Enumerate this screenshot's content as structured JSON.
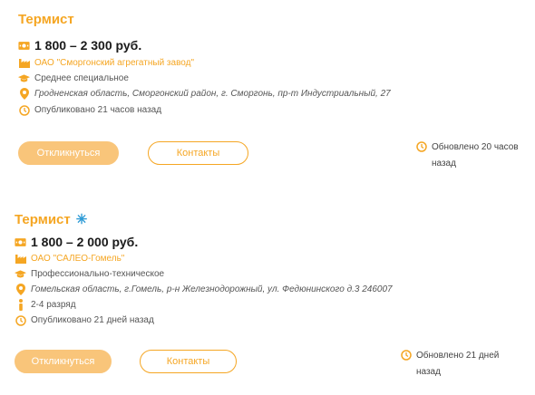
{
  "colors": {
    "accent": "#F5A623",
    "button_fill": "#F9C57A",
    "star": "#2E9BD6"
  },
  "vacancies": [
    {
      "title": "Термист",
      "salary": "1 800 – 2 300 руб.",
      "company": "ОАО \"Сморгонский агрегатный завод\"",
      "education": "Среднее специальное",
      "address": "Гродненская область, Сморгонский район, г. Сморгонь, пр-т Индустриальный, 27",
      "published": "Опубликовано 21 часов назад",
      "apply_label": "Откликнуться",
      "contacts_label": "Контакты",
      "updated": "Обновлено 20 часов назад",
      "icons": [
        "money-icon",
        "factory-icon",
        "graduation-cap-icon",
        "location-pin-icon",
        "clock-icon"
      ]
    },
    {
      "title": "Термист",
      "title_badge": "✳",
      "salary": "1 800 – 2 000 руб.",
      "company": "ОАО \"САЛЕО-Гомель\"",
      "education": "Профессионально-техническое",
      "address": "Гомельская область, г.Гомель, р-н Железнодорожный, ул. Федюнинского д.3 246007",
      "grade": "2-4 разряд",
      "published": "Опубликовано 21 дней назад",
      "apply_label": "Откликнуться",
      "contacts_label": "Контакты",
      "updated": "Обновлено 21 дней назад",
      "icons": [
        "money-icon",
        "factory-icon",
        "graduation-cap-icon",
        "location-pin-icon",
        "person-info-icon",
        "clock-icon"
      ]
    }
  ]
}
